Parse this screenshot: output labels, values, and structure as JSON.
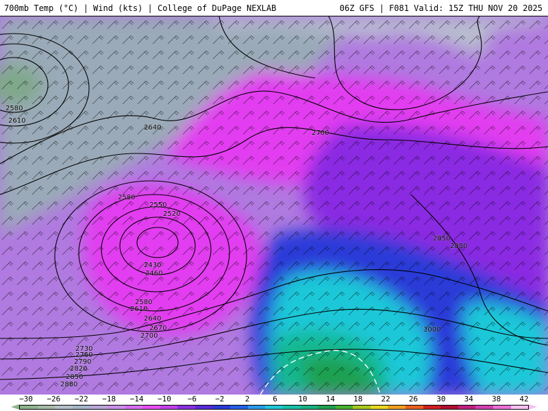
{
  "header": {
    "left_title": "700mb Temp (°C) | Wind (kts) | College of DuPage NEXLAB",
    "right_title": "06Z GFS | F081 Valid: 15Z THU NOV 20 2025"
  },
  "map": {
    "contour_labels": [
      "2580",
      "2610",
      "2640",
      "2700",
      "2580",
      "2550",
      "2520",
      "2430",
      "2460",
      "2580",
      "2610",
      "2640",
      "2670",
      "2700",
      "2730",
      "2760",
      "2790",
      "2820",
      "2850",
      "2880",
      "2850",
      "2880",
      "3000"
    ],
    "colors": {
      "cold_gray": "#9aaab8",
      "violet": "#b07ae0",
      "magenta": "#e23ef0",
      "purple": "#8a2be2",
      "blue": "#2b3ad8",
      "cyan": "#1ec8d8",
      "teal": "#18b890",
      "green": "#1ca050",
      "contour": "#000000",
      "zero_line": "#ffffff"
    }
  },
  "scale": {
    "ticks": [
      "−30",
      "−26",
      "−22",
      "−18",
      "−14",
      "−10",
      "−6",
      "−2",
      "2",
      "6",
      "10",
      "14",
      "18",
      "22",
      "26",
      "30",
      "34",
      "38",
      "42"
    ],
    "colors": [
      "#8fb38f",
      "#a7b9a7",
      "#b5c0c8",
      "#a4b6c8",
      "#b9a6d8",
      "#c890e6",
      "#d66ef0",
      "#e64ef2",
      "#c040e8",
      "#8a30e0",
      "#5a2ad8",
      "#2a3ad8",
      "#2660e8",
      "#2a9ae8",
      "#1ec8d8",
      "#18c0a8",
      "#18b080",
      "#20a050",
      "#48b030",
      "#a8c820",
      "#e8d820",
      "#f0a020",
      "#e86020",
      "#d02020",
      "#b01030",
      "#c02080",
      "#d040b0",
      "#e870d8",
      "#f5c0f0"
    ]
  }
}
